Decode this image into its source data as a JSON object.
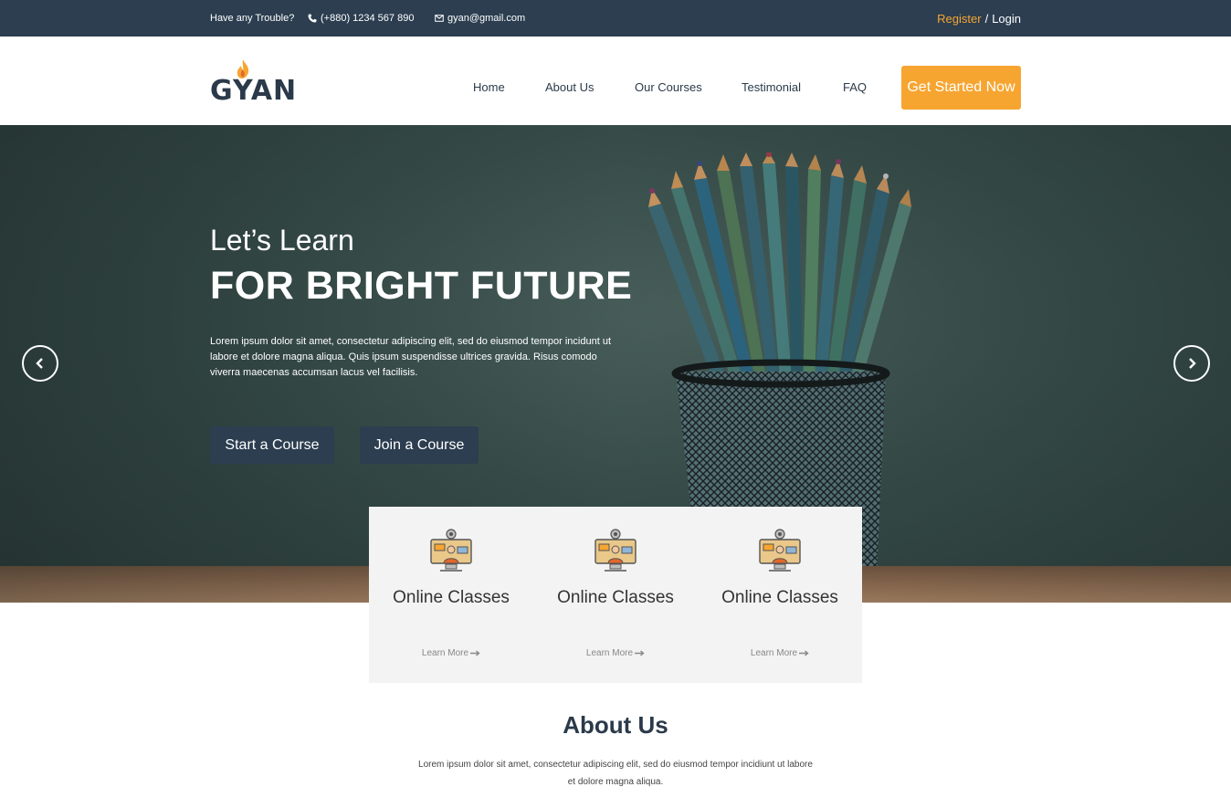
{
  "topbar": {
    "trouble": "Have any Trouble?",
    "phone": "(+880) 1234 567 890",
    "email": "gyan@gmail.com",
    "register": "Register",
    "separator": "/",
    "login": "Login",
    "phone_icon": "phone-icon",
    "email_icon": "envelope-icon"
  },
  "nav": {
    "logo": "GYAN",
    "links": [
      "Home",
      "About Us",
      "Our Courses",
      "Testimonial",
      "FAQ"
    ],
    "cta": "Get Started Now"
  },
  "hero": {
    "subtitle": "Let’s Learn",
    "title": "FOR BRIGHT FUTURE",
    "text": "Lorem ipsum dolor sit amet, consectetur adipiscing elit, sed do eiusmod tempor incidunt ut labore et dolore magna aliqua. Quis ipsum suspendisse ultrices gravida. Risus comodo viverra maecenas accumsan lacus vel facilisis.",
    "start_button": "Start a Course",
    "join_button": "Join a Course"
  },
  "features": [
    {
      "title": "Online Classes",
      "link": "Learn More",
      "icon": "online-class-icon"
    },
    {
      "title": "Online Classes",
      "link": "Learn More",
      "icon": "online-class-icon"
    },
    {
      "title": "Online Classes",
      "link": "Learn More",
      "icon": "online-class-icon"
    }
  ],
  "about": {
    "title": "About Us",
    "text": "Lorem ipsum dolor sit amet, consectetur adipiscing elit, sed do eiusmod tempor incidiunt ut labore et dolore magna aliqua."
  },
  "colors": {
    "dark": "#2c3e50",
    "accent": "#f7a531"
  }
}
